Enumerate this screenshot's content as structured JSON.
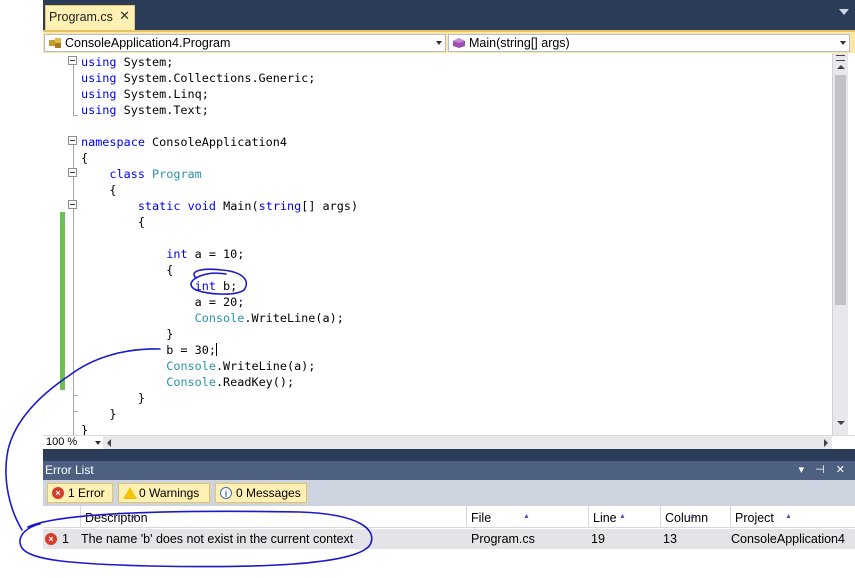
{
  "tab": {
    "title": "Program.cs",
    "close_glyph": "✕"
  },
  "nav": {
    "class_combo": "ConsoleApplication4.Program",
    "member_combo": "Main(string[] args)"
  },
  "code": [
    [
      {
        "t": "using",
        "c": "kw"
      },
      {
        "t": " System;"
      }
    ],
    [
      {
        "t": "using",
        "c": "kw"
      },
      {
        "t": " System.Collections.Generic;"
      }
    ],
    [
      {
        "t": "using",
        "c": "kw"
      },
      {
        "t": " System.Linq;"
      }
    ],
    [
      {
        "t": "using",
        "c": "kw"
      },
      {
        "t": " System.Text;"
      }
    ],
    [],
    [
      {
        "t": "namespace",
        "c": "kw"
      },
      {
        "t": " ConsoleApplication4"
      }
    ],
    [
      {
        "t": "{"
      }
    ],
    [
      {
        "t": "    "
      },
      {
        "t": "class",
        "c": "kw"
      },
      {
        "t": " "
      },
      {
        "t": "Program",
        "c": "ty"
      }
    ],
    [
      {
        "t": "    {"
      }
    ],
    [
      {
        "t": "        "
      },
      {
        "t": "static",
        "c": "kw"
      },
      {
        "t": " "
      },
      {
        "t": "void",
        "c": "kw"
      },
      {
        "t": " Main("
      },
      {
        "t": "string",
        "c": "kw"
      },
      {
        "t": "[] args)"
      }
    ],
    [
      {
        "t": "        {"
      }
    ],
    [],
    [
      {
        "t": "            "
      },
      {
        "t": "int",
        "c": "kw"
      },
      {
        "t": " a = 10;"
      }
    ],
    [
      {
        "t": "            {"
      }
    ],
    [
      {
        "t": "                "
      },
      {
        "t": "int",
        "c": "kw"
      },
      {
        "t": " b;"
      }
    ],
    [
      {
        "t": "                a = 20;"
      }
    ],
    [
      {
        "t": "                "
      },
      {
        "t": "Console",
        "c": "ty"
      },
      {
        "t": ".WriteLine(a);"
      }
    ],
    [
      {
        "t": "            }"
      }
    ],
    [
      {
        "t": "            b = 30;"
      }
    ],
    [
      {
        "t": "            "
      },
      {
        "t": "Console",
        "c": "ty"
      },
      {
        "t": ".WriteLine(a);"
      }
    ],
    [
      {
        "t": "            "
      },
      {
        "t": "Console",
        "c": "ty"
      },
      {
        "t": ".ReadKey();"
      }
    ],
    [
      {
        "t": "        }"
      }
    ],
    [
      {
        "t": "    }"
      }
    ],
    [
      {
        "t": "}"
      }
    ]
  ],
  "zoom": "100 %",
  "error_list": {
    "title": "Error List",
    "titlebar_icons": "▾ ⊣ ✕",
    "filters": {
      "errors": "1 Error",
      "warnings": "0 Warnings",
      "messages": "0 Messages"
    },
    "columns": [
      "Description",
      "File",
      "Line",
      "Column",
      "Project"
    ],
    "rows": [
      {
        "index": "1",
        "description": "The name 'b' does not exist in the current context",
        "file": "Program.cs",
        "line": "19",
        "column": "13",
        "project": "ConsoleApplication4"
      }
    ]
  },
  "colors": {
    "keyword": "#0000ff",
    "type": "#2b91af",
    "chrome_dark": "#2b3c59",
    "tab_active": "#fff0b3",
    "change_bar": "#6cbf53",
    "annotation": "#1a1acc"
  }
}
